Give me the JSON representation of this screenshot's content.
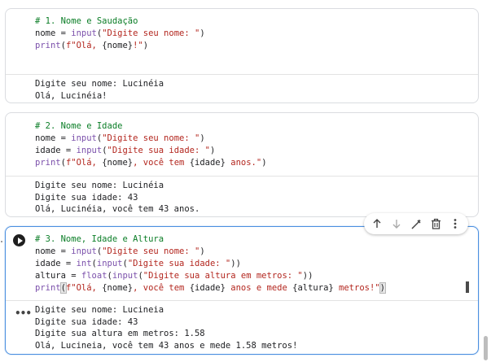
{
  "cells": [
    {
      "code": [
        [
          {
            "t": "# 1. Nome e Saudação",
            "c": "cm"
          }
        ],
        [
          {
            "t": "nome = ",
            "c": "kw"
          },
          {
            "t": "input",
            "c": "fn"
          },
          {
            "t": "(",
            "c": "kw"
          },
          {
            "t": "\"Digite seu nome: \"",
            "c": "str"
          },
          {
            "t": ")",
            "c": "kw"
          }
        ],
        [
          {
            "t": "print",
            "c": "fn"
          },
          {
            "t": "(",
            "c": "kw"
          },
          {
            "t": "f\"Olá, ",
            "c": "str"
          },
          {
            "t": "{nome}",
            "c": "kw"
          },
          {
            "t": "!\"",
            "c": "str"
          },
          {
            "t": ")",
            "c": "kw"
          }
        ]
      ],
      "output": [
        "Digite seu nome: Lucinéia",
        "Olá, Lucinéia!"
      ]
    },
    {
      "code": [
        [
          {
            "t": "# 2. Nome e Idade",
            "c": "cm"
          }
        ],
        [
          {
            "t": "nome = ",
            "c": "kw"
          },
          {
            "t": "input",
            "c": "fn"
          },
          {
            "t": "(",
            "c": "kw"
          },
          {
            "t": "\"Digite seu nome: \"",
            "c": "str"
          },
          {
            "t": ")",
            "c": "kw"
          }
        ],
        [
          {
            "t": "idade = ",
            "c": "kw"
          },
          {
            "t": "input",
            "c": "fn"
          },
          {
            "t": "(",
            "c": "kw"
          },
          {
            "t": "\"Digite sua idade: \"",
            "c": "str"
          },
          {
            "t": ")",
            "c": "kw"
          }
        ],
        [
          {
            "t": "print",
            "c": "fn"
          },
          {
            "t": "(",
            "c": "kw"
          },
          {
            "t": "f\"Olá, ",
            "c": "str"
          },
          {
            "t": "{nome}",
            "c": "kw"
          },
          {
            "t": ", você tem ",
            "c": "str"
          },
          {
            "t": "{idade}",
            "c": "kw"
          },
          {
            "t": " anos.\"",
            "c": "str"
          },
          {
            "t": ")",
            "c": "kw"
          }
        ]
      ],
      "output": [
        "Digite seu nome: Lucinéia",
        "Digite sua idade: 43",
        "Olá, Lucinéia, você tem 43 anos."
      ]
    },
    {
      "code": [
        [
          {
            "t": "# 3. Nome, Idade e Altura",
            "c": "cm"
          }
        ],
        [
          {
            "t": "nome = ",
            "c": "kw"
          },
          {
            "t": "input",
            "c": "fn"
          },
          {
            "t": "(",
            "c": "kw"
          },
          {
            "t": "\"Digite seu nome: \"",
            "c": "str"
          },
          {
            "t": ")",
            "c": "kw"
          }
        ],
        [
          {
            "t": "idade = ",
            "c": "kw"
          },
          {
            "t": "int",
            "c": "fn"
          },
          {
            "t": "(",
            "c": "kw"
          },
          {
            "t": "input",
            "c": "fn"
          },
          {
            "t": "(",
            "c": "kw"
          },
          {
            "t": "\"Digite sua idade: \"",
            "c": "str"
          },
          {
            "t": "))",
            "c": "kw"
          }
        ],
        [
          {
            "t": "altura = ",
            "c": "kw"
          },
          {
            "t": "float",
            "c": "fn"
          },
          {
            "t": "(",
            "c": "kw"
          },
          {
            "t": "input",
            "c": "fn"
          },
          {
            "t": "(",
            "c": "kw"
          },
          {
            "t": "\"Digite sua altura em metros: \"",
            "c": "str"
          },
          {
            "t": "))",
            "c": "kw"
          }
        ],
        [
          {
            "t": "print",
            "c": "fn"
          },
          {
            "t": "(",
            "c": "hl"
          },
          {
            "t": "f\"Olá, ",
            "c": "str"
          },
          {
            "t": "{nome}",
            "c": "kw"
          },
          {
            "t": ", você tem ",
            "c": "str"
          },
          {
            "t": "{idade}",
            "c": "kw"
          },
          {
            "t": " anos e mede ",
            "c": "str"
          },
          {
            "t": "{altura}",
            "c": "kw"
          },
          {
            "t": " metros!\"",
            "c": "str"
          },
          {
            "t": ")",
            "c": "hl"
          }
        ]
      ],
      "output": [
        "Digite seu nome: Lucineia",
        "Digite sua idade: 43",
        "Digite sua altura em metros: 1.58",
        "Olá, Lucineia, você tem 43 anos e mede 1.58 metros!"
      ]
    }
  ],
  "toolbar": [
    "move-up-icon",
    "move-down-icon",
    "edit-icon",
    "delete-icon",
    "more-icon"
  ],
  "colors": {
    "comment": "#0a7d26",
    "string": "#b3261e",
    "function": "#7b50ab",
    "active_border": "#4a8fe0"
  }
}
